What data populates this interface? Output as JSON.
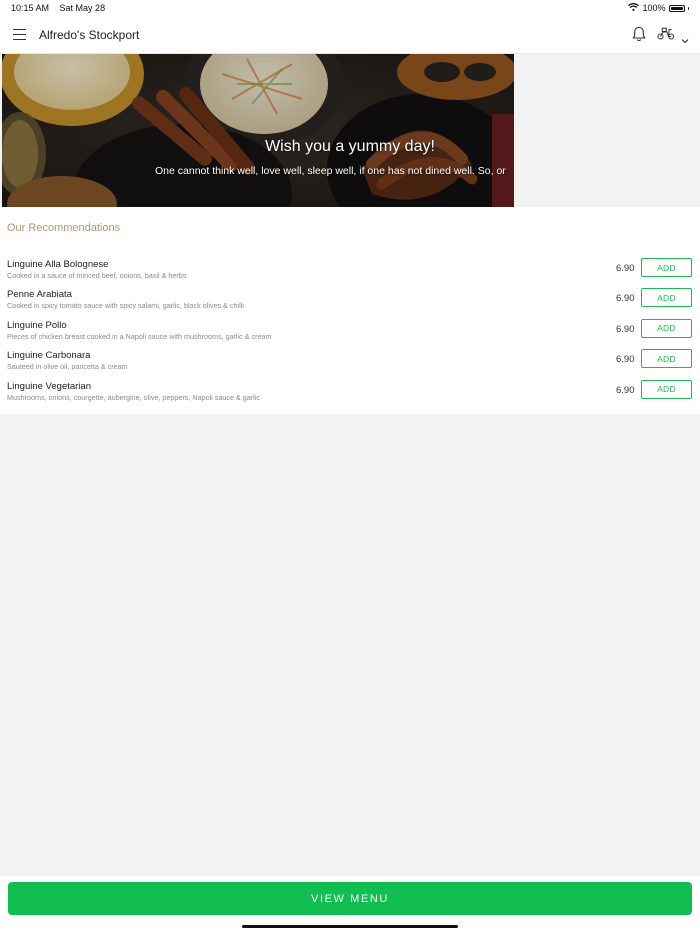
{
  "status_bar": {
    "time": "10:15 AM",
    "date": "Sat May 28",
    "battery": "100%"
  },
  "header": {
    "store_name": "Alfredo's Stockport",
    "icons": [
      "menu-icon",
      "bell-icon",
      "scooter-icon",
      "chevron-down-icon"
    ]
  },
  "banner": {
    "title": "Wish you a yummy day!",
    "subtitle": "One cannot think well, love well, sleep well, if one has not dined well. So, or"
  },
  "recommendations": {
    "title": "Our Recommendations",
    "add_label": "ADD",
    "items": [
      {
        "name": "Linguine Alla Bolognese",
        "description": "Cooked in a sauce of minced beef, onions, basil & herbs",
        "price": "6.90"
      },
      {
        "name": "Penne Arabiata",
        "description": "Cooked in spicy tomato sauce with spicy salami, garlic, black olives & chilli",
        "price": "6.90"
      },
      {
        "name": "Linguine Pollo",
        "description": "Pieces of chicken breast cooked in a Napoli sauce with mushrooms, garlic & cream",
        "price": "6.90"
      },
      {
        "name": "Linguine Carbonara",
        "description": "Sauteed in olive oil, pancetta & cream",
        "price": "6.90"
      },
      {
        "name": "Linguine Vegetarian",
        "description": "Mushrooms, onions, courgette, aubergine, olive, peppers, Napoli sauce & garlic",
        "price": "6.90"
      }
    ]
  },
  "footer": {
    "view_menu_label": "VIEW MENU"
  },
  "colors": {
    "accent_green": "#12be50",
    "section_title": "#b3966b",
    "background": "#f2f2f2"
  }
}
